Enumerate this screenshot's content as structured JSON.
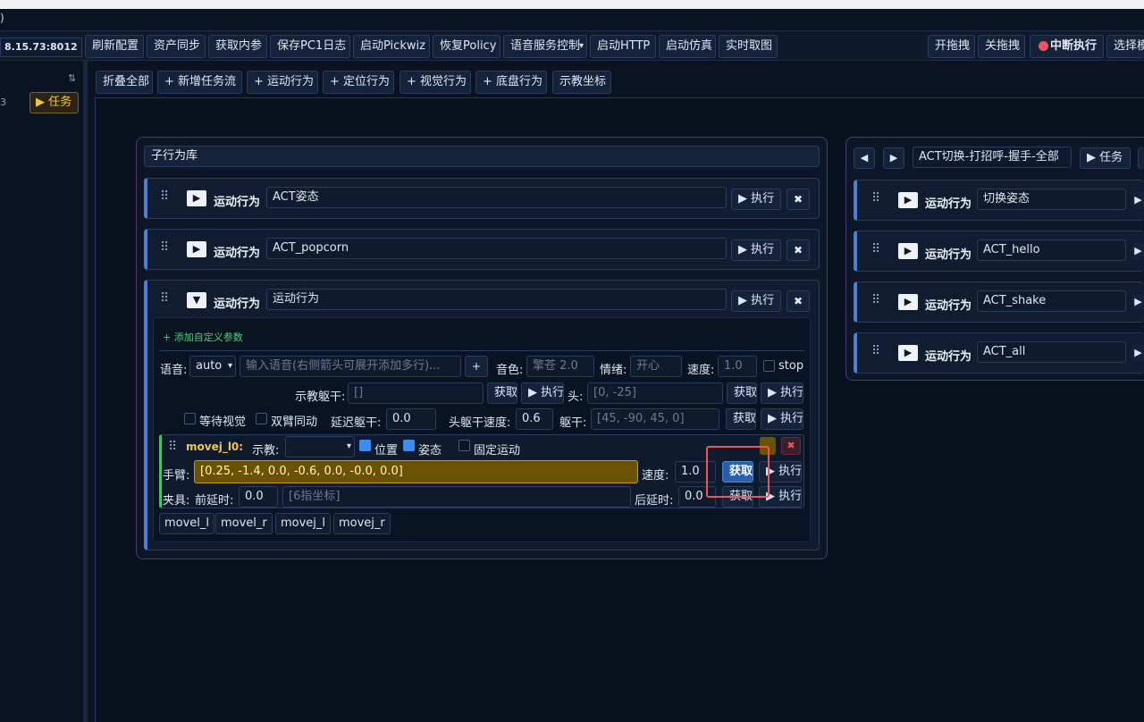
{
  "window": {
    "title_fragment": ")"
  },
  "toolbar": {
    "address": "8.15.73:8012",
    "buttons": [
      "刷新配置",
      "资产同步",
      "获取内参",
      "保存PC1日志",
      "启动Pickwiz",
      "恢复Policy",
      "语音服务控制",
      "启动HTTP",
      "启动仿真",
      "实时取图"
    ],
    "right_buttons": [
      "开拖拽",
      "关拖拽",
      "中断执行",
      "选择模"
    ],
    "dropdown_caret": "▾"
  },
  "sidebar": {
    "sort_icon": "⇅",
    "task_button": "▶ 任务"
  },
  "actions_bar": [
    "折叠全部",
    "+ 新增任务流",
    "+ 运动行为",
    "+ 定位行为",
    "+ 视觉行为",
    "+ 底盘行为",
    "示教坐标"
  ],
  "left_panel": {
    "title": "子行为库",
    "cards": [
      {
        "type": "运动行为",
        "name": "ACT姿态",
        "expanded": false
      },
      {
        "type": "运动行为",
        "name": "ACT_popcorn",
        "expanded": false
      },
      {
        "type": "运动行为",
        "name": "运动行为",
        "expanded": true
      }
    ],
    "exec_label": "▶ 执行",
    "close_label": "✖",
    "play_icon": "▶",
    "expanded_icon": "▼",
    "grip": "⠿",
    "expanded": {
      "add_param": "+ 添加自定义参数",
      "voice_label": "语音:",
      "voice_value": "auto",
      "voice_placeholder": "输入语音(右侧箭头可展开添加多行)...",
      "plus": "+",
      "timbre_label": "音色:",
      "timbre_placeholder": "擎苍 2.0",
      "emotion_label": "情绪:",
      "emotion_placeholder": "开心",
      "speed_label": "速度:",
      "speed_placeholder": "1.0",
      "stop_label": "stop",
      "teach_torso_label": "示教躯干:",
      "teach_torso_value": "[]",
      "get_label": "获取",
      "exec_label": "▶ 执行",
      "head_label": "头:",
      "head_placeholder": "[0, -25]",
      "wait_vision_label": "等待视觉",
      "dual_arm_label": "双臂同动",
      "delay_torso_label": "延迟躯干:",
      "delay_torso_value": "0.0",
      "head_torso_speed_label": "头躯干速度:",
      "head_torso_speed_value": "0.6",
      "torso_label": "躯干:",
      "torso_placeholder": "[45, -90, 45, 0]",
      "movej": {
        "name": "movej_l0:",
        "teach_label": "示教:",
        "position_label": "位置",
        "pose_label": "姿态",
        "fixed_motion_label": "固定运动",
        "arm_label": "手臂:",
        "arm_value": "[0.25, -1.4, 0.0, -0.6, 0.0, -0.0, 0.0]",
        "speed_label": "速度:",
        "speed_value": "1.0",
        "get_label": "获取",
        "exec_label": "▶ 执行",
        "gripper_label": "夹具:",
        "pre_delay_label": "前延时:",
        "pre_delay_value": "0.0",
        "finger_placeholder": "[6指坐标]",
        "post_delay_label": "后延时:",
        "post_delay_value": "0.0",
        "close_icon": "✖"
      },
      "bottom_tags": [
        "movel_l",
        "movel_r",
        "movej_l",
        "movej_r"
      ]
    }
  },
  "right_panel": {
    "prev": "◀",
    "next": "▶",
    "flow_name": "ACT切换-打招呼-握手-全部",
    "task_button": "▶ 任务",
    "cards": [
      {
        "type": "运动行为",
        "name": "切换姿态"
      },
      {
        "type": "运动行为",
        "name": "ACT_hello"
      },
      {
        "type": "运动行为",
        "name": "ACT_shake"
      },
      {
        "type": "运动行为",
        "name": "ACT_all"
      }
    ]
  },
  "colors": {
    "accent": "#4e7fd6",
    "panel_border": "#4b3a78",
    "highlight": "#f0545a",
    "arm_field": "#6b5200",
    "stop_dot": "#f0545a"
  }
}
